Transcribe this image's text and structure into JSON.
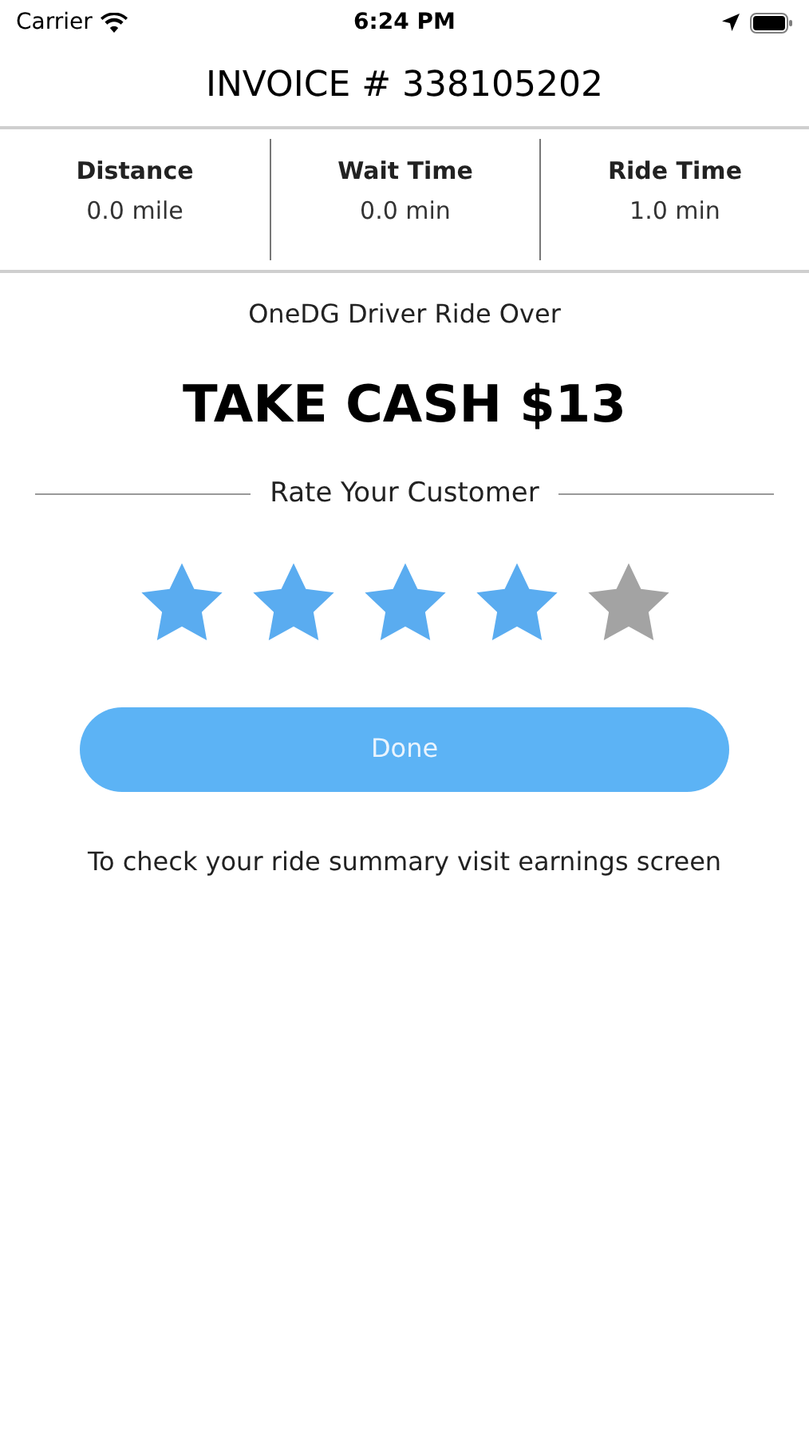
{
  "status_bar": {
    "carrier": "Carrier",
    "time": "6:24 PM"
  },
  "title": "INVOICE # 338105202",
  "stats": [
    {
      "label": "Distance",
      "value": "0.0 mile"
    },
    {
      "label": "Wait Time",
      "value": "0.0 min"
    },
    {
      "label": "Ride Time",
      "value": "1.0 min"
    }
  ],
  "subtitle": "OneDG Driver Ride Over",
  "amount": "TAKE CASH $13",
  "rating": {
    "label": "Rate Your Customer",
    "stars": 4
  },
  "done_button": "Done",
  "note": "To check your ride summary visit earnings screen"
}
